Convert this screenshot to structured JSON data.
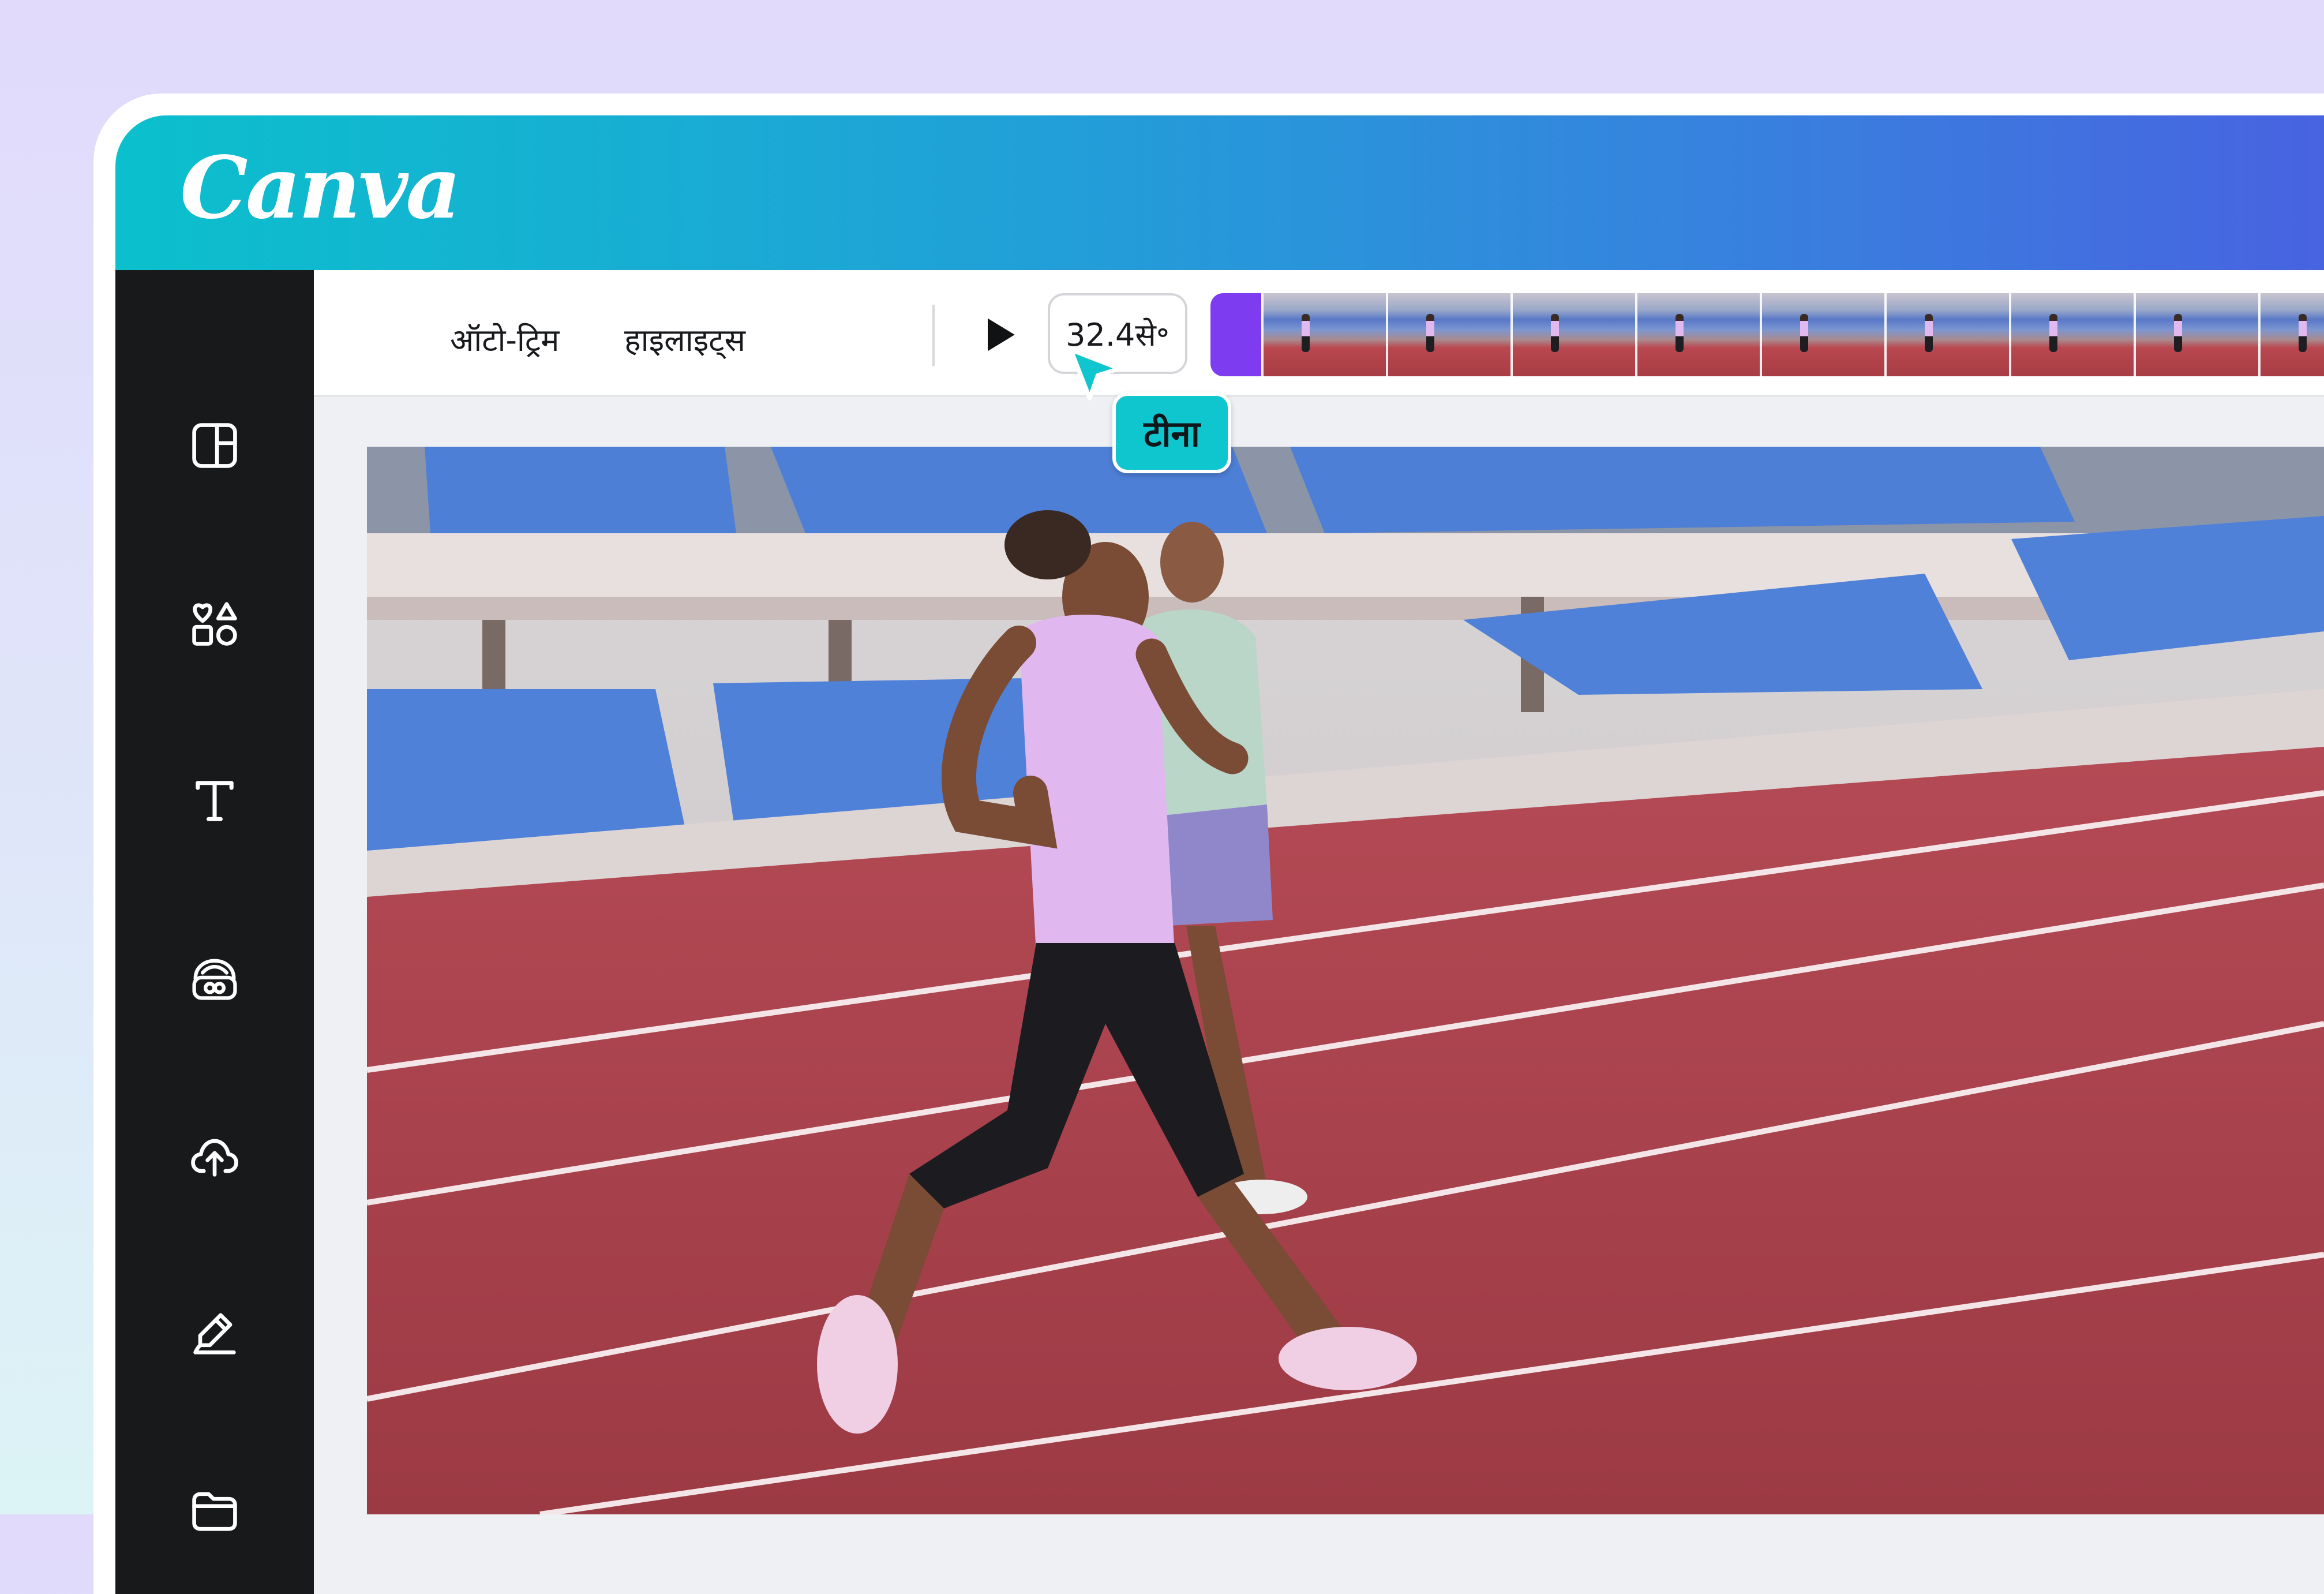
{
  "app": {
    "logo": "Canva"
  },
  "sidebar": {
    "items": [
      {
        "icon": "layout-panel-icon"
      },
      {
        "icon": "elements-shapes-icon"
      },
      {
        "icon": "text-icon"
      },
      {
        "icon": "brand-kit-icon"
      },
      {
        "icon": "upload-cloud-icon"
      },
      {
        "icon": "draw-pen-icon"
      },
      {
        "icon": "projects-folder-icon"
      }
    ]
  },
  "toolbar": {
    "auto_trim_label": "ऑटो-ट्रिम",
    "highlights_label": "हाइलाइट्स",
    "play_icon": "play-icon",
    "duration": "32.4से॰"
  },
  "collaborator": {
    "name": "टीना",
    "color": "#0fc6cf"
  },
  "colors": {
    "brand_gradient_start": "#0bc0cc",
    "brand_gradient_end": "#4a5fe0",
    "trim_handle": "#7d3cf0",
    "sidebar_bg": "#18191b"
  }
}
